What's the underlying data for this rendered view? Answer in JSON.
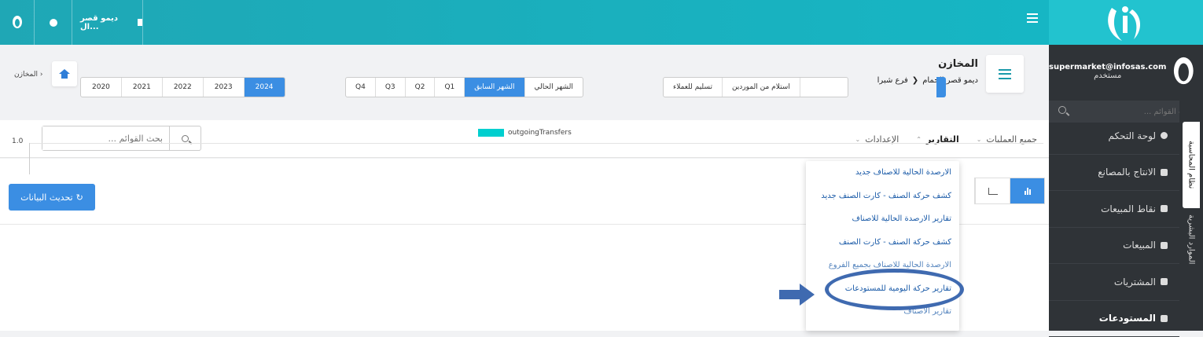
{
  "topbar": {
    "company": "ديمو قصر ال...",
    "menu_icon": "hamburger-icon",
    "language_icon": "globe-icon"
  },
  "sidebar": {
    "user_email": "supermarket@infosas.com",
    "user_role": "مستخدم",
    "search_placeholder": "بحث القوائم ...",
    "items": [
      {
        "label": "لوحة التحكم",
        "icon": "dashboard-icon"
      },
      {
        "label": "الانتاج بالمصانع",
        "icon": "factory-icon"
      },
      {
        "label": "نقاط المبيعات",
        "icon": "pos-icon"
      },
      {
        "label": "المبيعات",
        "icon": "truck-icon"
      },
      {
        "label": "المشتريات",
        "icon": "money-icon"
      },
      {
        "label": "المستودعات",
        "icon": "warehouse-icon"
      }
    ],
    "vertical_tabs": [
      "نظام المحاسبة",
      "الموارد البشرية"
    ]
  },
  "header": {
    "title": "المخازن",
    "path_company": "ديمو قصر الحمام",
    "path_branch": "فرع شبرا",
    "breadcrumb": "المخازن"
  },
  "nav": {
    "items": [
      {
        "label": "جميع العمليات",
        "active": false
      },
      {
        "label": "التقارير",
        "active": true
      },
      {
        "label": "الإعدادات",
        "active": false
      }
    ],
    "search_placeholder": "بحث القوائم ..."
  },
  "toolbar": {
    "refresh_label": "تحديث البيانات"
  },
  "filters": {
    "years": [
      "2020",
      "2021",
      "2022",
      "2023",
      "2024"
    ],
    "selected_year": "2024",
    "periods": [
      "Q4",
      "Q3",
      "Q2",
      "Q1",
      "الشهر السابق",
      "الشهر الحالي"
    ],
    "selected_period": "الشهر السابق",
    "ops": [
      "تسليم للعملاء",
      "استلام من الموردين",
      ""
    ]
  },
  "chart_data": {
    "type": "bar",
    "series": [
      {
        "name": "outgoingTransfers",
        "values": []
      }
    ],
    "y_tick_top": "1.0",
    "legend_color": "#00cfcf"
  },
  "dropdown": {
    "items": [
      "الارصدة الحالية للاصناف جديد",
      "كشف حركة الصنف - كارت الصنف جديد",
      "تقارير الارصدة الحالية للاصناف",
      "كشف حركة الصنف - كارت الصنف",
      "الارصدة الحالية للاصناف بجميع الفروع",
      "تقارير حركة اليومية للمستودعات",
      "تقارير الاصناف"
    ],
    "highlighted": "تقارير حركة اليومية للمستودعات"
  },
  "colors": {
    "accent": "#3b8ee3",
    "topbar": "#16b6c4",
    "sidebar": "#2f3337",
    "annotation": "#3f6ab0"
  }
}
